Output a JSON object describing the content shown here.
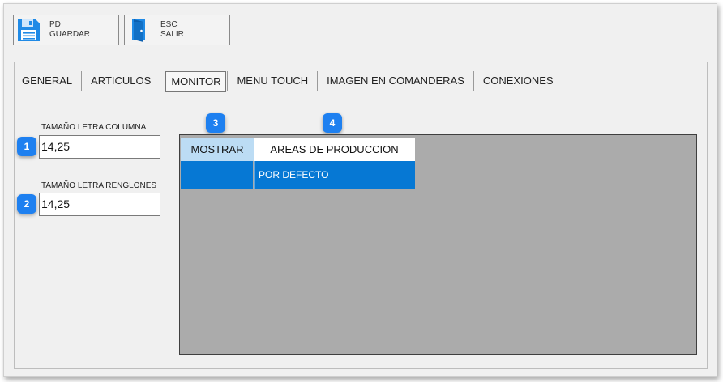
{
  "toolbar": {
    "save": {
      "key": "PD",
      "label": "GUARDAR",
      "icon": "floppy-disk-icon"
    },
    "exit": {
      "key": "ESC",
      "label": "SALIR",
      "icon": "exit-door-icon"
    }
  },
  "tabs": [
    "GENERAL",
    "ARTICULOS",
    "MONITOR",
    "MENU TOUCH",
    "IMAGEN EN COMANDERAS",
    "CONEXIONES"
  ],
  "active_tab": "MONITOR",
  "fields": {
    "column_font": {
      "label": "TAMAÑO LETRA COLUMNA",
      "value": "14,25"
    },
    "row_font": {
      "label": "TAMAÑO LETRA RENGLONES",
      "value": "14,25"
    }
  },
  "markers": [
    "1",
    "2",
    "3",
    "4"
  ],
  "grid": {
    "headers": [
      "MOSTRAR",
      "AREAS DE PRODUCCION"
    ],
    "rows": [
      {
        "mostrar": "",
        "area": "POR DEFECTO"
      }
    ]
  },
  "colors": {
    "accent": "#0678d4",
    "marker": "#1e80f0",
    "grid_bg": "#ababab",
    "header_highlight": "#bcdcf4"
  }
}
